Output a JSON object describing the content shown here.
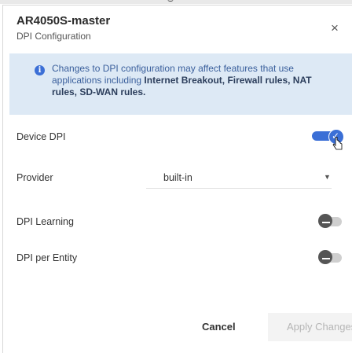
{
  "dialog": {
    "title": "AR4050S-master",
    "subtitle": "DPI Configuration",
    "close_label": "×"
  },
  "notice": {
    "text_part1": "Changes to DPI configuration may affect features that use applications including ",
    "text_bold": "Internet Breakout, Firewall rules, NAT rules, SD-WAN rules.",
    "icon": "info-icon"
  },
  "rows": {
    "device_dpi": {
      "label": "Device DPI",
      "enabled": true
    },
    "provider": {
      "label": "Provider",
      "value": "built-in"
    },
    "dpi_learning": {
      "label": "DPI Learning",
      "enabled": false
    },
    "dpi_per_entity": {
      "label": "DPI per Entity",
      "enabled": false
    }
  },
  "buttons": {
    "cancel": "Cancel",
    "apply": "Apply Changes"
  },
  "colors": {
    "accent": "#3b6fd6",
    "notice_bg": "#dde9f5",
    "toggle_off": "#555555"
  }
}
